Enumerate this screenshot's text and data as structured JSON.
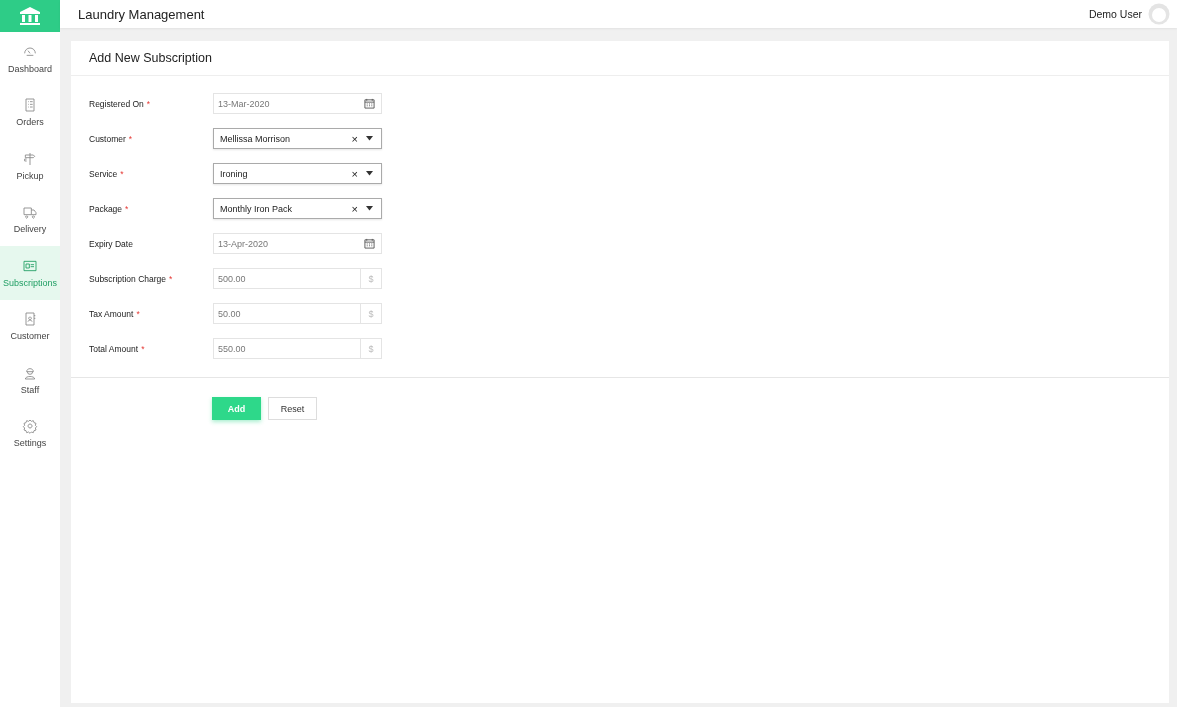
{
  "app": {
    "title": "Laundry Management"
  },
  "user": {
    "name": "Demo User"
  },
  "sidebar": {
    "items": [
      {
        "label": "Dashboard",
        "selected": false
      },
      {
        "label": "Orders",
        "selected": false
      },
      {
        "label": "Pickup",
        "selected": false
      },
      {
        "label": "Delivery",
        "selected": false
      },
      {
        "label": "Subscriptions",
        "selected": true
      },
      {
        "label": "Customer",
        "selected": false
      },
      {
        "label": "Staff",
        "selected": false
      },
      {
        "label": "Settings",
        "selected": false
      }
    ]
  },
  "form": {
    "title": "Add New Subscription",
    "fields": [
      {
        "label": "Registered On",
        "marker": "*",
        "kind": "date",
        "value": "13-Mar-2020"
      },
      {
        "label": "Customer",
        "marker": "*",
        "kind": "select",
        "value": "Mellissa Morrison",
        "clear": "×"
      },
      {
        "label": "Service",
        "marker": "*",
        "kind": "select",
        "value": "Ironing",
        "clear": "×"
      },
      {
        "label": "Package",
        "marker": "*",
        "kind": "select",
        "value": "Monthly Iron Pack",
        "clear": "×"
      },
      {
        "label": "Expiry Date",
        "kind": "date",
        "value": "13-Apr-2020"
      },
      {
        "label": "Subscription Charge",
        "marker": "*",
        "kind": "currency",
        "value": "500.00",
        "addon": "$"
      },
      {
        "label": "Tax Amount",
        "marker": "*",
        "kind": "currency",
        "value": "50.00",
        "addon": "$"
      },
      {
        "label": "Total Amount",
        "marker": "*",
        "kind": "currency",
        "value": "550.00",
        "addon": "$"
      }
    ],
    "buttons": [
      {
        "label": "Add",
        "kind": "primary"
      },
      {
        "label": "Reset",
        "kind": "secondary"
      }
    ]
  }
}
